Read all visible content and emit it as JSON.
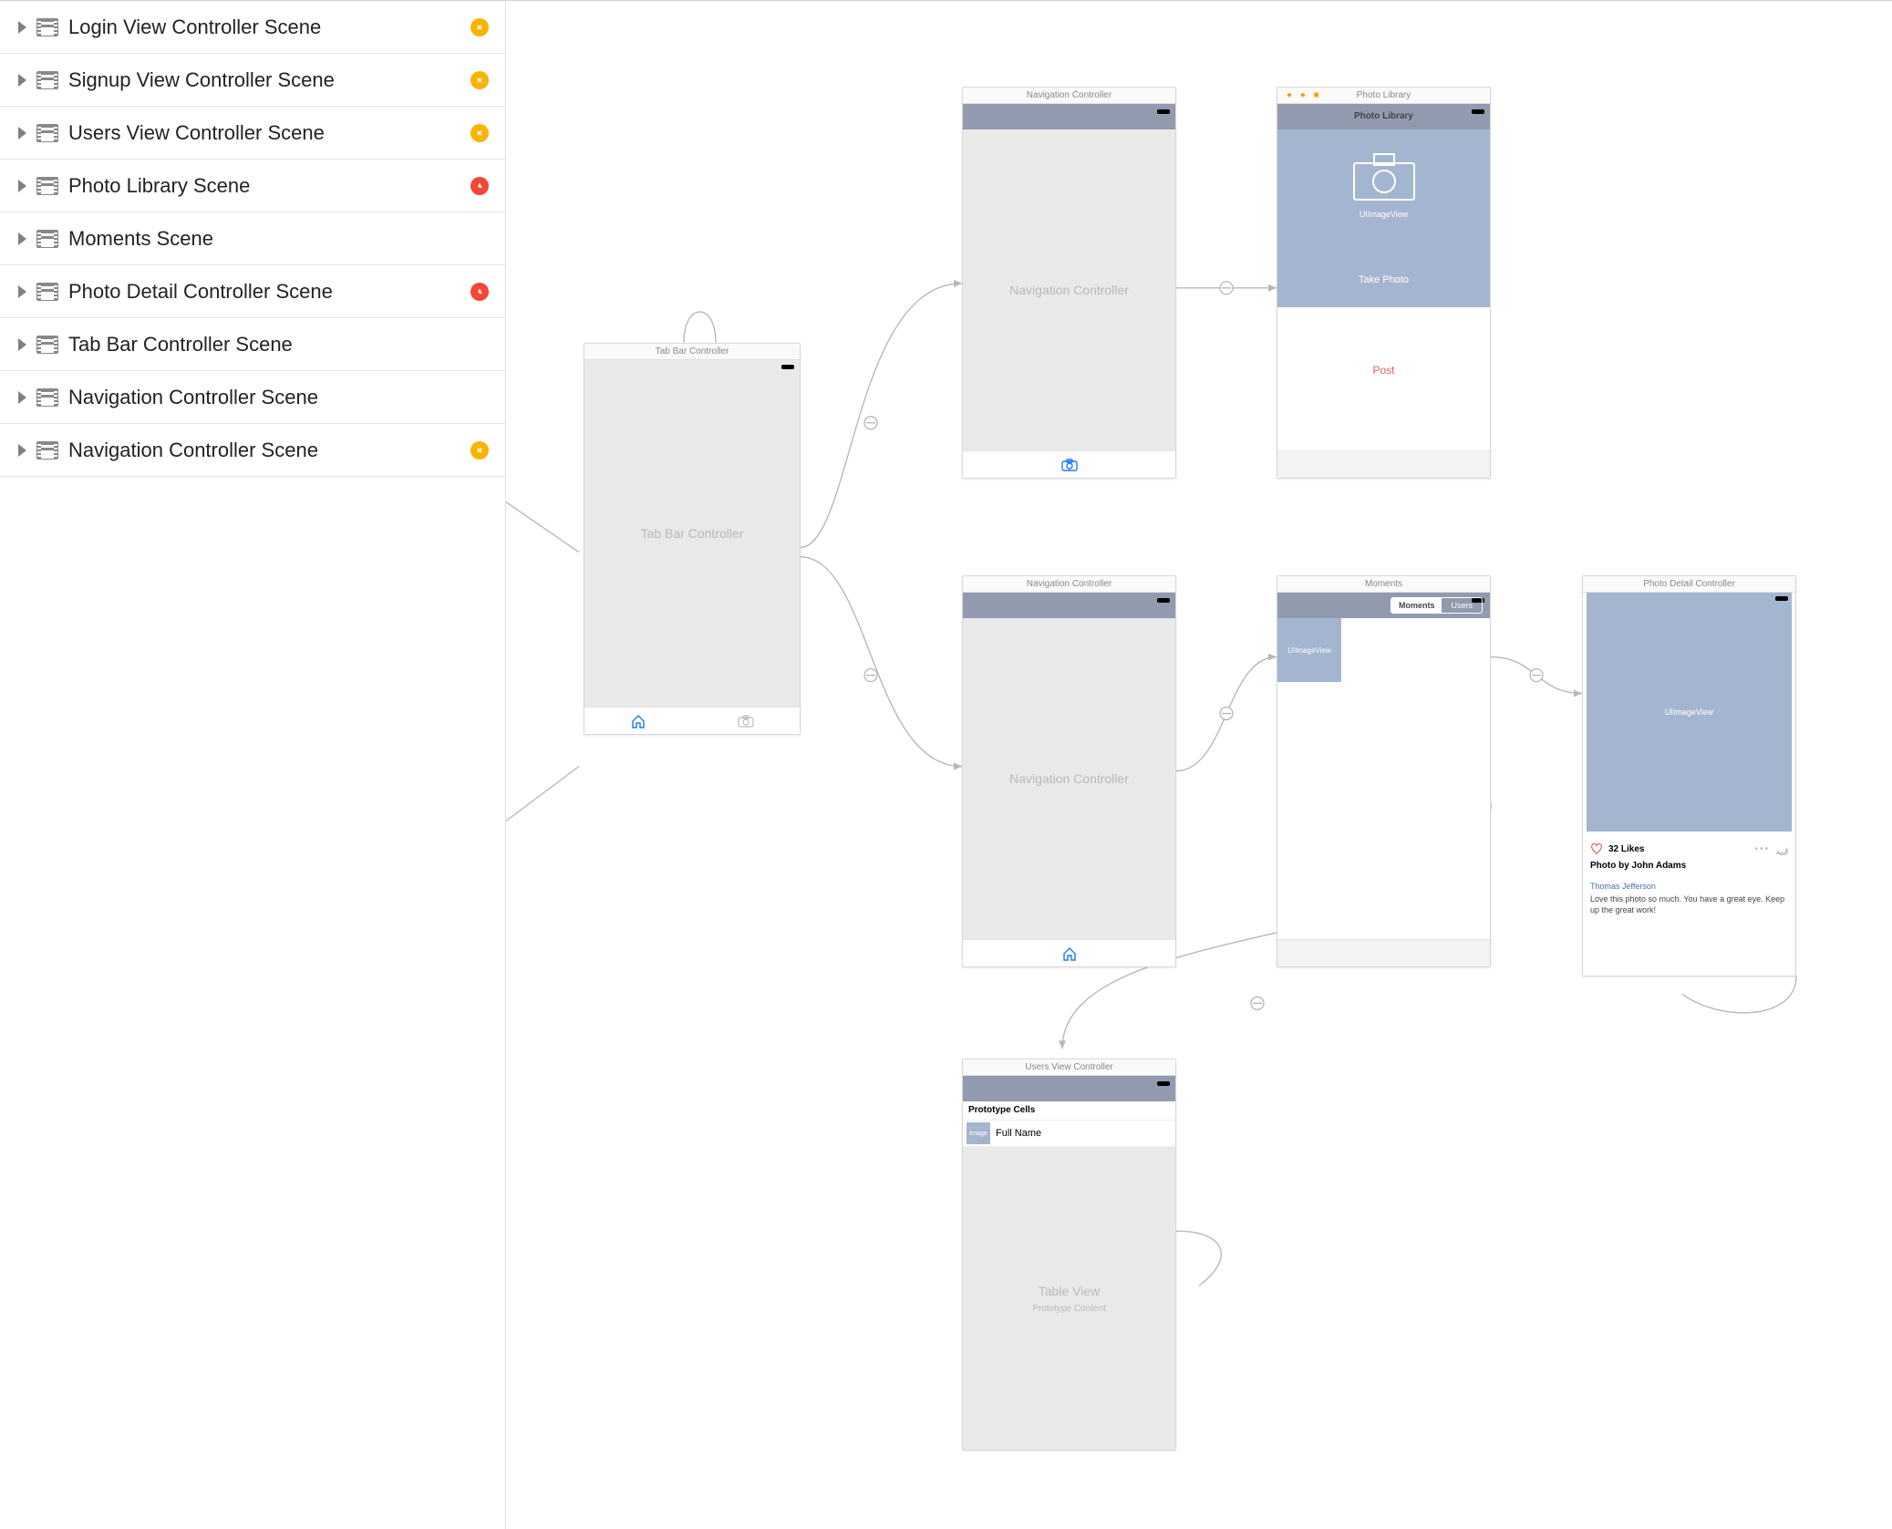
{
  "sidebar": {
    "items": [
      {
        "label": "Login View Controller Scene",
        "badge": "yellow"
      },
      {
        "label": "Signup View Controller Scene",
        "badge": "yellow"
      },
      {
        "label": "Users View Controller Scene",
        "badge": "yellow"
      },
      {
        "label": "Photo Library Scene",
        "badge": "red"
      },
      {
        "label": "Moments Scene",
        "badge": null
      },
      {
        "label": "Photo Detail Controller Scene",
        "badge": "red"
      },
      {
        "label": "Tab Bar Controller Scene",
        "badge": null
      },
      {
        "label": "Navigation Controller Scene",
        "badge": null
      },
      {
        "label": "Navigation Controller Scene",
        "badge": "yellow"
      }
    ]
  },
  "canvas": {
    "tabbar": {
      "title": "Tab Bar Controller",
      "body": "Tab Bar Controller"
    },
    "nav1": {
      "title": "Navigation Controller",
      "body": "Navigation Controller"
    },
    "nav2": {
      "title": "Navigation Controller",
      "body": "Navigation Controller"
    },
    "photoLib": {
      "title": "Photo Library",
      "imgLabel": "UIImageView",
      "takePhoto": "Take Photo",
      "post": "Post"
    },
    "moments": {
      "title": "Moments",
      "segMoments": "Moments",
      "segUsers": "Users",
      "thumb": "UIImageView"
    },
    "users": {
      "title": "Users View Controller",
      "proto": "Prototype Cells",
      "img": "Image",
      "fullname": "Full Name",
      "tableview": "Table View",
      "protoContent": "Prototype Content"
    },
    "detail": {
      "title": "Photo Detail Controller",
      "imgLabel": "UIImageView",
      "likes": "32 Likes",
      "photoBy": "Photo by John Adams",
      "commenter": "Thomas Jefferson",
      "comment": "Love this photo so much. You have a great eye. Keep up the great work!"
    }
  }
}
